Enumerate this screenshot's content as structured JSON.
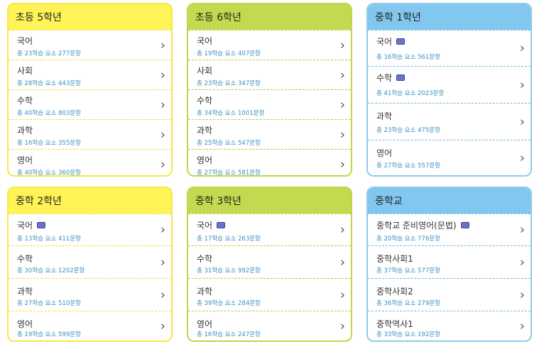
{
  "cards": [
    {
      "title": "초등 5학년",
      "items": [
        {
          "name": "국어",
          "meta": "총 23학습 요소 277문항"
        },
        {
          "name": "사회",
          "meta": "총 28학습 요소 443문항"
        },
        {
          "name": "수학",
          "meta": "총 40학습 요소 803문항"
        },
        {
          "name": "과학",
          "meta": "총 16학습 요소 355문항"
        },
        {
          "name": "영어",
          "meta": "총 40학습 요소 360문항"
        }
      ]
    },
    {
      "title": "초등 6학년",
      "items": [
        {
          "name": "국어",
          "meta": "총 19학습 요소 407문항"
        },
        {
          "name": "사회",
          "meta": "총 23학습 요소 347문항"
        },
        {
          "name": "수학",
          "meta": "총 34학습 요소 1001문항"
        },
        {
          "name": "과학",
          "meta": "총 25학습 요소 547문항"
        },
        {
          "name": "영어",
          "meta": "총 27학습 요소 581문항"
        }
      ]
    },
    {
      "title": "중학 1학년",
      "items": [
        {
          "name": "국어",
          "meta": "총 16학습 요소 561문항"
        },
        {
          "name": "수학",
          "meta": "총 41학습 요소 2023문항"
        },
        {
          "name": "과학",
          "meta": "총 23학습 요소 475문항"
        },
        {
          "name": "영어",
          "meta": "총 27학습 요소 557문항"
        }
      ]
    },
    {
      "title": "중학 2학년",
      "items": [
        {
          "name": "국어",
          "meta": "총 13학습 요소 411문항"
        },
        {
          "name": "수학",
          "meta": "총 30학습 요소 1202문항"
        },
        {
          "name": "과학",
          "meta": "총 27학습 요소 510문항"
        },
        {
          "name": "영어",
          "meta": "총 19학습 요소 599문항"
        }
      ]
    },
    {
      "title": "중학 3학년",
      "items": [
        {
          "name": "국어",
          "meta": "총 17학습 요소 263문항"
        },
        {
          "name": "수학",
          "meta": "총 31학습 요소 992문항"
        },
        {
          "name": "과학",
          "meta": "총 39학습 요소 284문항"
        },
        {
          "name": "영어",
          "meta": "총 16학습 요소 247문항"
        }
      ]
    },
    {
      "title": "중학교",
      "items": [
        {
          "name": "중학교 준비영어(문법)",
          "meta": "총 20학습 요소 776문항"
        },
        {
          "name": "중학사회1",
          "meta": "총 37학습 요소 577문항"
        },
        {
          "name": "중학사회2",
          "meta": "총 36학습 요소 279문항"
        },
        {
          "name": "중학역사1",
          "meta": "총 33학습 요소 192문항"
        }
      ]
    }
  ]
}
